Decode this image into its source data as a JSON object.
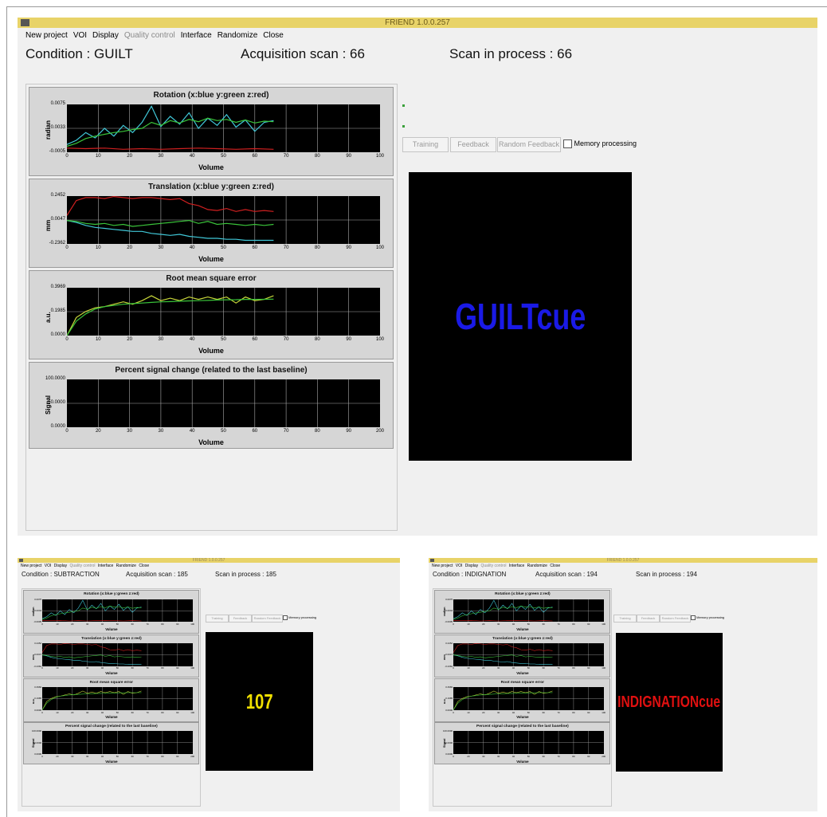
{
  "main": {
    "title": "FRIEND 1.0.0.257",
    "menu": [
      {
        "label": "New project",
        "enabled": true
      },
      {
        "label": "VOI",
        "enabled": true
      },
      {
        "label": "Display",
        "enabled": true
      },
      {
        "label": "Quality control",
        "enabled": false
      },
      {
        "label": "Interface",
        "enabled": true
      },
      {
        "label": "Randomize",
        "enabled": true
      },
      {
        "label": "Close",
        "enabled": true
      }
    ],
    "condition": "Condition : GUILT",
    "acquisition": "Acquisition scan : 66",
    "in_process": "Scan in process : 66",
    "buttons": [
      "Training",
      "Feedback",
      "Random Feedback"
    ],
    "checkbox_label": "Memory processing",
    "cue_text": "GUILTcue",
    "cue_color": "#1a1ae6",
    "charts": [
      {
        "title": "Rotation (x:blue y:green z:red)",
        "ylabel": "radian",
        "yticks": [
          "0.0075",
          "0.0033",
          "-0.0005"
        ],
        "xticks": [
          "0",
          "10",
          "20",
          "30",
          "40",
          "50",
          "60",
          "70",
          "80",
          "90",
          "100"
        ],
        "xlabel": "Volume"
      },
      {
        "title": "Translation (x:blue y:green z:red)",
        "ylabel": "mm",
        "yticks": [
          "0.2452",
          "0.0047",
          "-0.2362"
        ],
        "xticks": [
          "0",
          "10",
          "20",
          "30",
          "40",
          "50",
          "60",
          "70",
          "80",
          "90",
          "100"
        ],
        "xlabel": "Volume"
      },
      {
        "title": "Root mean square error",
        "ylabel": "a.u.",
        "yticks": [
          "0.3969",
          "0.1985",
          "0.0000"
        ],
        "xticks": [
          "0",
          "10",
          "20",
          "30",
          "40",
          "50",
          "60",
          "70",
          "80",
          "90",
          "100"
        ],
        "xlabel": "Volume"
      },
      {
        "title": "Percent signal change (related to the last baseline)",
        "ylabel": "Signal",
        "yticks": [
          "100.0000",
          "50.0000",
          "0.0000"
        ],
        "xticks": [
          "0",
          "20",
          "30",
          "30",
          "40",
          "50",
          "60",
          "70",
          "80",
          "90",
          "200"
        ],
        "xlabel": "Volume"
      }
    ]
  },
  "sub1": {
    "title": "FRIEND 1.0.0.257",
    "condition": "Condition : SUBTRACTION",
    "acquisition": "Acquisition scan : 185",
    "in_process": "Scan in process : 185",
    "cue_text": "107",
    "cue_color": "#f0e000"
  },
  "sub2": {
    "title": "FRIEND 1.0.0.257",
    "condition": "Condition : INDIGNATION",
    "acquisition": "Acquisition scan : 194",
    "in_process": "Scan in process : 194",
    "cue_text": "INDIGNATIONcue",
    "cue_color": "#e01010"
  },
  "chart_data": [
    {
      "type": "line",
      "title": "Rotation (x:blue y:green z:red)",
      "xlabel": "Volume",
      "ylabel": "radian",
      "xlim": [
        0,
        100
      ],
      "ylim": [
        -0.0005,
        0.0075
      ],
      "series": [
        {
          "name": "x",
          "color": "#40c8d8",
          "x": [
            0,
            3,
            6,
            9,
            12,
            15,
            18,
            21,
            24,
            27,
            30,
            33,
            36,
            39,
            42,
            45,
            48,
            51,
            54,
            57,
            60,
            63,
            66
          ],
          "values": [
            0.0008,
            0.0015,
            0.0028,
            0.0019,
            0.0035,
            0.0022,
            0.004,
            0.0028,
            0.0045,
            0.0072,
            0.0038,
            0.0055,
            0.0042,
            0.0061,
            0.0035,
            0.0052,
            0.004,
            0.0058,
            0.0037,
            0.0049,
            0.003,
            0.0045,
            0.0048
          ]
        },
        {
          "name": "y",
          "color": "#3ac43a",
          "x": [
            0,
            3,
            6,
            9,
            12,
            15,
            18,
            21,
            24,
            27,
            30,
            33,
            36,
            39,
            42,
            45,
            48,
            51,
            54,
            57,
            60,
            63,
            66
          ],
          "values": [
            0.0005,
            0.001,
            0.0018,
            0.0022,
            0.0025,
            0.0028,
            0.003,
            0.0033,
            0.0035,
            0.0045,
            0.004,
            0.0048,
            0.0044,
            0.005,
            0.0046,
            0.0052,
            0.0048,
            0.005,
            0.0045,
            0.0049,
            0.0044,
            0.0047,
            0.0046
          ]
        },
        {
          "name": "z",
          "color": "#d02020",
          "x": [
            0,
            6,
            12,
            18,
            24,
            30,
            36,
            42,
            48,
            54,
            60,
            66
          ],
          "values": [
            0.0002,
            0.0001,
            0.0002,
            0.0,
            0.0001,
            0.0,
            0.0001,
            0.0002,
            0.0001,
            0.0,
            0.0001,
            0.0
          ]
        }
      ]
    },
    {
      "type": "line",
      "title": "Translation (x:blue y:green z:red)",
      "xlabel": "Volume",
      "ylabel": "mm",
      "xlim": [
        0,
        100
      ],
      "ylim": [
        -0.2362,
        0.2452
      ],
      "series": [
        {
          "name": "x",
          "color": "#40c8d8",
          "x": [
            0,
            3,
            6,
            9,
            12,
            15,
            18,
            21,
            24,
            27,
            30,
            33,
            36,
            39,
            42,
            45,
            48,
            51,
            54,
            57,
            60,
            63,
            66
          ],
          "values": [
            0.0,
            -0.02,
            -0.05,
            -0.07,
            -0.08,
            -0.09,
            -0.1,
            -0.11,
            -0.11,
            -0.13,
            -0.14,
            -0.15,
            -0.14,
            -0.16,
            -0.17,
            -0.18,
            -0.18,
            -0.19,
            -0.19,
            -0.2,
            -0.2,
            -0.2,
            -0.2
          ]
        },
        {
          "name": "y",
          "color": "#3ac43a",
          "x": [
            0,
            3,
            6,
            9,
            12,
            15,
            18,
            21,
            24,
            27,
            30,
            33,
            36,
            39,
            42,
            45,
            48,
            51,
            54,
            57,
            60,
            63,
            66
          ],
          "values": [
            0.0,
            -0.01,
            -0.03,
            -0.04,
            -0.03,
            -0.05,
            -0.04,
            -0.06,
            -0.05,
            -0.04,
            -0.03,
            -0.02,
            -0.01,
            0.0,
            -0.03,
            -0.01,
            -0.04,
            -0.03,
            -0.04,
            -0.05,
            -0.04,
            -0.05,
            -0.04
          ]
        },
        {
          "name": "z",
          "color": "#d02020",
          "x": [
            0,
            3,
            6,
            9,
            12,
            15,
            18,
            21,
            24,
            27,
            30,
            33,
            36,
            39,
            42,
            45,
            48,
            51,
            54,
            57,
            60,
            63,
            66
          ],
          "values": [
            0.05,
            0.2,
            0.23,
            0.23,
            0.22,
            0.24,
            0.23,
            0.22,
            0.23,
            0.23,
            0.22,
            0.21,
            0.22,
            0.17,
            0.15,
            0.11,
            0.1,
            0.12,
            0.09,
            0.11,
            0.09,
            0.1,
            0.09
          ]
        }
      ]
    },
    {
      "type": "line",
      "title": "Root mean square error",
      "xlabel": "Volume",
      "ylabel": "a.u.",
      "xlim": [
        0,
        100
      ],
      "ylim": [
        0.0,
        0.3969
      ],
      "series": [
        {
          "name": "rms",
          "color": "#c8d83a",
          "x": [
            0,
            3,
            6,
            9,
            12,
            15,
            18,
            21,
            24,
            27,
            30,
            33,
            36,
            39,
            42,
            45,
            48,
            51,
            54,
            57,
            60,
            63,
            66
          ],
          "values": [
            0.0,
            0.15,
            0.2,
            0.23,
            0.24,
            0.26,
            0.28,
            0.26,
            0.29,
            0.33,
            0.29,
            0.31,
            0.29,
            0.32,
            0.3,
            0.32,
            0.3,
            0.32,
            0.27,
            0.32,
            0.29,
            0.3,
            0.33
          ]
        },
        {
          "name": "mean",
          "color": "#3ac43a",
          "x": [
            0,
            3,
            6,
            9,
            12,
            15,
            18,
            21,
            24,
            27,
            30,
            33,
            36,
            39,
            42,
            45,
            48,
            51,
            54,
            57,
            60,
            63,
            66
          ],
          "values": [
            0.0,
            0.12,
            0.18,
            0.22,
            0.24,
            0.25,
            0.26,
            0.265,
            0.27,
            0.275,
            0.28,
            0.282,
            0.285,
            0.288,
            0.29,
            0.292,
            0.295,
            0.297,
            0.298,
            0.3,
            0.3,
            0.301,
            0.302
          ]
        }
      ]
    },
    {
      "type": "line",
      "title": "Percent signal change (related to the last baseline)",
      "xlabel": "Volume",
      "ylabel": "Signal",
      "ylim": [
        0.0,
        100.0
      ],
      "series": []
    }
  ]
}
